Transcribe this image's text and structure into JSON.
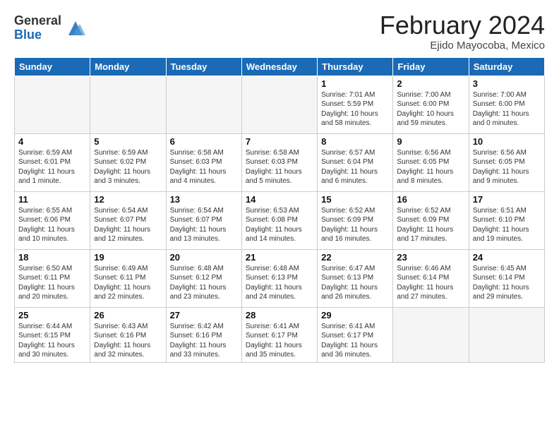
{
  "logo": {
    "general": "General",
    "blue": "Blue"
  },
  "title": "February 2024",
  "subtitle": "Ejido Mayocoba, Mexico",
  "weekdays": [
    "Sunday",
    "Monday",
    "Tuesday",
    "Wednesday",
    "Thursday",
    "Friday",
    "Saturday"
  ],
  "weeks": [
    [
      {
        "day": "",
        "info": ""
      },
      {
        "day": "",
        "info": ""
      },
      {
        "day": "",
        "info": ""
      },
      {
        "day": "",
        "info": ""
      },
      {
        "day": "1",
        "info": "Sunrise: 7:01 AM\nSunset: 5:59 PM\nDaylight: 10 hours and 58 minutes."
      },
      {
        "day": "2",
        "info": "Sunrise: 7:00 AM\nSunset: 6:00 PM\nDaylight: 10 hours and 59 minutes."
      },
      {
        "day": "3",
        "info": "Sunrise: 7:00 AM\nSunset: 6:00 PM\nDaylight: 11 hours and 0 minutes."
      }
    ],
    [
      {
        "day": "4",
        "info": "Sunrise: 6:59 AM\nSunset: 6:01 PM\nDaylight: 11 hours and 1 minute."
      },
      {
        "day": "5",
        "info": "Sunrise: 6:59 AM\nSunset: 6:02 PM\nDaylight: 11 hours and 3 minutes."
      },
      {
        "day": "6",
        "info": "Sunrise: 6:58 AM\nSunset: 6:03 PM\nDaylight: 11 hours and 4 minutes."
      },
      {
        "day": "7",
        "info": "Sunrise: 6:58 AM\nSunset: 6:03 PM\nDaylight: 11 hours and 5 minutes."
      },
      {
        "day": "8",
        "info": "Sunrise: 6:57 AM\nSunset: 6:04 PM\nDaylight: 11 hours and 6 minutes."
      },
      {
        "day": "9",
        "info": "Sunrise: 6:56 AM\nSunset: 6:05 PM\nDaylight: 11 hours and 8 minutes."
      },
      {
        "day": "10",
        "info": "Sunrise: 6:56 AM\nSunset: 6:05 PM\nDaylight: 11 hours and 9 minutes."
      }
    ],
    [
      {
        "day": "11",
        "info": "Sunrise: 6:55 AM\nSunset: 6:06 PM\nDaylight: 11 hours and 10 minutes."
      },
      {
        "day": "12",
        "info": "Sunrise: 6:54 AM\nSunset: 6:07 PM\nDaylight: 11 hours and 12 minutes."
      },
      {
        "day": "13",
        "info": "Sunrise: 6:54 AM\nSunset: 6:07 PM\nDaylight: 11 hours and 13 minutes."
      },
      {
        "day": "14",
        "info": "Sunrise: 6:53 AM\nSunset: 6:08 PM\nDaylight: 11 hours and 14 minutes."
      },
      {
        "day": "15",
        "info": "Sunrise: 6:52 AM\nSunset: 6:09 PM\nDaylight: 11 hours and 16 minutes."
      },
      {
        "day": "16",
        "info": "Sunrise: 6:52 AM\nSunset: 6:09 PM\nDaylight: 11 hours and 17 minutes."
      },
      {
        "day": "17",
        "info": "Sunrise: 6:51 AM\nSunset: 6:10 PM\nDaylight: 11 hours and 19 minutes."
      }
    ],
    [
      {
        "day": "18",
        "info": "Sunrise: 6:50 AM\nSunset: 6:11 PM\nDaylight: 11 hours and 20 minutes."
      },
      {
        "day": "19",
        "info": "Sunrise: 6:49 AM\nSunset: 6:11 PM\nDaylight: 11 hours and 22 minutes."
      },
      {
        "day": "20",
        "info": "Sunrise: 6:48 AM\nSunset: 6:12 PM\nDaylight: 11 hours and 23 minutes."
      },
      {
        "day": "21",
        "info": "Sunrise: 6:48 AM\nSunset: 6:13 PM\nDaylight: 11 hours and 24 minutes."
      },
      {
        "day": "22",
        "info": "Sunrise: 6:47 AM\nSunset: 6:13 PM\nDaylight: 11 hours and 26 minutes."
      },
      {
        "day": "23",
        "info": "Sunrise: 6:46 AM\nSunset: 6:14 PM\nDaylight: 11 hours and 27 minutes."
      },
      {
        "day": "24",
        "info": "Sunrise: 6:45 AM\nSunset: 6:14 PM\nDaylight: 11 hours and 29 minutes."
      }
    ],
    [
      {
        "day": "25",
        "info": "Sunrise: 6:44 AM\nSunset: 6:15 PM\nDaylight: 11 hours and 30 minutes."
      },
      {
        "day": "26",
        "info": "Sunrise: 6:43 AM\nSunset: 6:16 PM\nDaylight: 11 hours and 32 minutes."
      },
      {
        "day": "27",
        "info": "Sunrise: 6:42 AM\nSunset: 6:16 PM\nDaylight: 11 hours and 33 minutes."
      },
      {
        "day": "28",
        "info": "Sunrise: 6:41 AM\nSunset: 6:17 PM\nDaylight: 11 hours and 35 minutes."
      },
      {
        "day": "29",
        "info": "Sunrise: 6:41 AM\nSunset: 6:17 PM\nDaylight: 11 hours and 36 minutes."
      },
      {
        "day": "",
        "info": ""
      },
      {
        "day": "",
        "info": ""
      }
    ]
  ]
}
